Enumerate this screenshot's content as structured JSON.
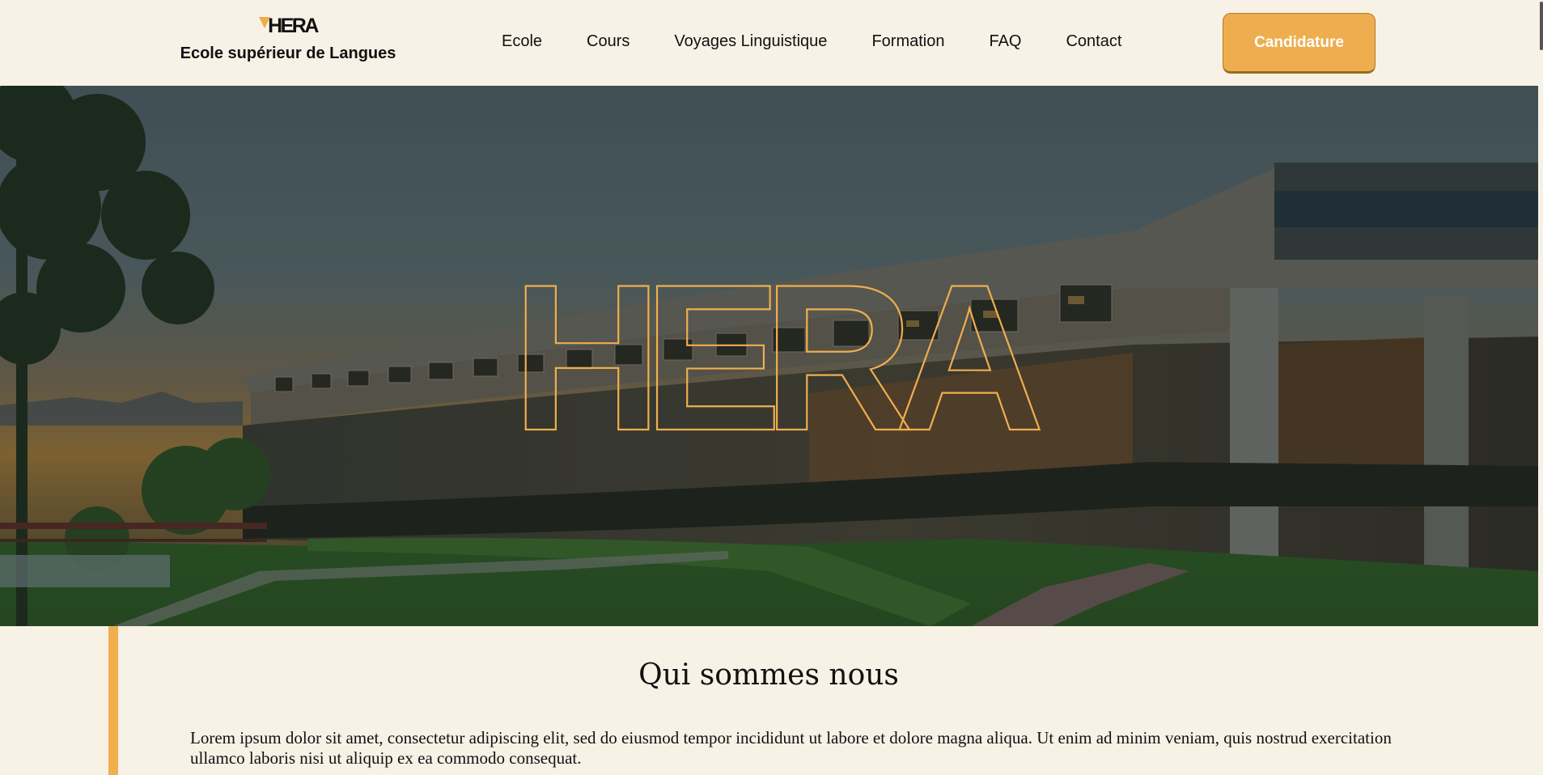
{
  "header": {
    "logo_text": "HERA",
    "subtitle": "Ecole supérieur de Langues",
    "nav": [
      "Ecole",
      "Cours",
      "Voyages Linguistique",
      "Formation",
      "FAQ",
      "Contact"
    ],
    "cta_label": "Candidature"
  },
  "hero": {
    "outline_text": "HERA"
  },
  "about": {
    "title": "Qui sommes nous",
    "text": "Lorem ipsum dolor sit amet, consectetur adipiscing elit, sed do eiusmod tempor incididunt ut labore et dolore magna aliqua. Ut enim ad minim veniam, quis nostrud exercitation ullamco laboris nisi ut aliquip ex ea commodo consequat."
  },
  "colors": {
    "background": "#f8f1e6",
    "accent": "#eeae4f",
    "text": "#111111"
  },
  "icons": [
    "hera-logo-triangle-icon"
  ]
}
